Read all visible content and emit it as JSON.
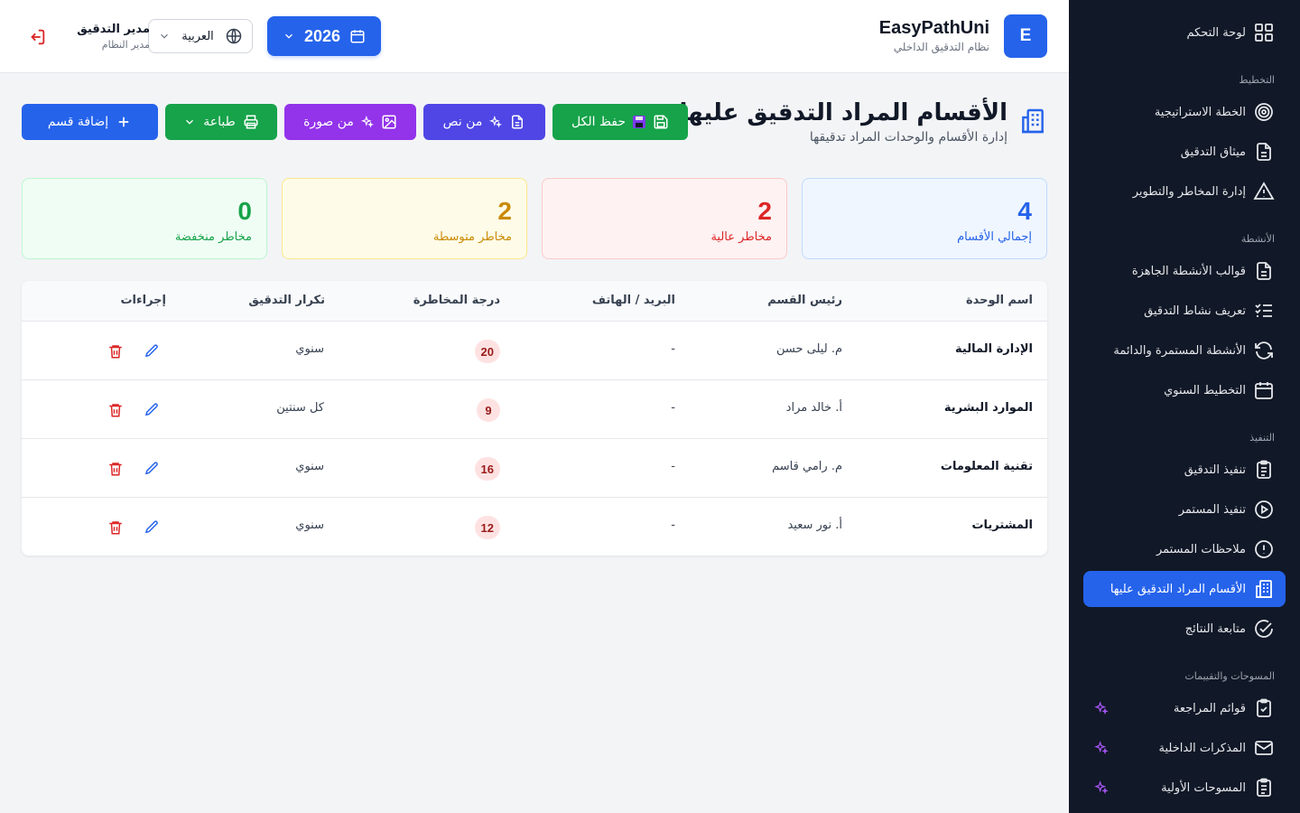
{
  "app": {
    "logo_letter": "E",
    "name": "EasyPathUni",
    "subtitle": "نظام التدقيق الداخلي"
  },
  "header": {
    "year": "2026",
    "language": "العربية",
    "user_name": "مدير التدقيق",
    "user_role": "مدير النظام"
  },
  "sidebar": {
    "dashboard": "لوحة التحكم",
    "sections": {
      "planning": "التخطيط",
      "activities": "الأنشطة",
      "execution": "التنفيذ",
      "surveys": "المسوحات والتقييمات"
    },
    "items": [
      {
        "label": "الخطة الاستراتيجية",
        "icon": "target-icon"
      },
      {
        "label": "ميثاق التدقيق",
        "icon": "document-icon"
      },
      {
        "label": "إدارة المخاطر والتطوير",
        "icon": "warning-icon"
      },
      {
        "label": "قوالب الأنشطة الجاهزة",
        "icon": "document-icon"
      },
      {
        "label": "تعريف نشاط التدقيق",
        "icon": "checklist-icon"
      },
      {
        "label": "الأنشطة المستمرة والدائمة",
        "icon": "refresh-icon"
      },
      {
        "label": "التخطيط السنوي",
        "icon": "calendar-icon"
      },
      {
        "label": "تنفيذ التدقيق",
        "icon": "clipboard-icon"
      },
      {
        "label": "تنفيذ المستمر",
        "icon": "play-icon"
      },
      {
        "label": "ملاحظات المستمر",
        "icon": "alert-circle-icon"
      },
      {
        "label": "الأقسام المراد التدقيق عليها",
        "icon": "building-icon"
      },
      {
        "label": "متابعة النتائج",
        "icon": "check-circle-icon"
      },
      {
        "label": "قوائم المراجعة",
        "icon": "clipboard-check-icon"
      },
      {
        "label": "المذكرات الداخلية",
        "icon": "mail-icon"
      },
      {
        "label": "المسوحات الأولية",
        "icon": "clipboard-icon"
      }
    ]
  },
  "page": {
    "title": "الأقسام المراد التدقيق عليها",
    "subtitle": "إدارة الأقسام والوحدات المراد تدقيقها"
  },
  "actions": {
    "save_all": "حفظ الكل",
    "from_text": "من نص",
    "from_image": "من صورة",
    "print": "طباعة",
    "add_department": "إضافة قسم"
  },
  "stats": [
    {
      "value": "4",
      "label": "إجمالي الأقسام",
      "color": "#2563eb"
    },
    {
      "value": "2",
      "label": "مخاطر عالية",
      "color": "#dc2626"
    },
    {
      "value": "2",
      "label": "مخاطر متوسطة",
      "color": "#ca8a04"
    },
    {
      "value": "0",
      "label": "مخاطر منخفضة",
      "color": "#16a34a"
    }
  ],
  "table": {
    "columns": [
      "اسم الوحدة",
      "رئيس القسم",
      "البريد / الهاتف",
      "درجة المخاطرة",
      "تكرار التدقيق",
      "إجراءات"
    ],
    "rows": [
      {
        "name": "الإدارة المالية",
        "head": "م. ليلى حسن",
        "contact": "-",
        "risk": "20",
        "frequency": "سنوي"
      },
      {
        "name": "الموارد البشرية",
        "head": "أ. خالد مراد",
        "contact": "-",
        "risk": "9",
        "frequency": "كل سنتين"
      },
      {
        "name": "تقنية المعلومات",
        "head": "م. رامي قاسم",
        "contact": "-",
        "risk": "16",
        "frequency": "سنوي"
      },
      {
        "name": "المشتريات",
        "head": "أ. نور سعيد",
        "contact": "-",
        "risk": "12",
        "frequency": "سنوي"
      }
    ]
  },
  "colors": {
    "primary": "#2563eb",
    "sidebar_bg": "#111827",
    "success": "#16a34a",
    "indigo": "#4f46e5",
    "purple": "#9333ea",
    "danger": "#dc2626"
  }
}
